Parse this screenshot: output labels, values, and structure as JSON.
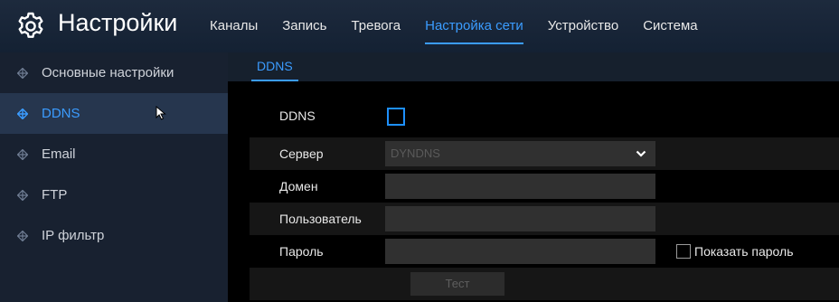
{
  "header": {
    "title": "Настройки",
    "gear_icon": "gear-icon"
  },
  "menu": {
    "items": [
      {
        "label": "Каналы"
      },
      {
        "label": "Запись"
      },
      {
        "label": "Тревога"
      },
      {
        "label": "Настройка сети",
        "active": true
      },
      {
        "label": "Устройство"
      },
      {
        "label": "Система"
      }
    ]
  },
  "sidebar": {
    "items": [
      {
        "label": "Основные настройки",
        "icon": "diamond-icon"
      },
      {
        "label": "DDNS",
        "icon": "diamond-icon",
        "active": true
      },
      {
        "label": "Email",
        "icon": "diamond-icon"
      },
      {
        "label": "FTP",
        "icon": "diamond-icon"
      },
      {
        "label": "IP фильтр",
        "icon": "diamond-icon"
      }
    ]
  },
  "tabs": [
    {
      "label": "DDNS",
      "active": true
    }
  ],
  "form": {
    "ddns": {
      "label": "DDNS",
      "checked": false
    },
    "server": {
      "label": "Сервер",
      "value": "DYNDNS"
    },
    "domain": {
      "label": "Домен",
      "value": ""
    },
    "user": {
      "label": "Пользователь",
      "value": ""
    },
    "password": {
      "label": "Пароль",
      "value": "",
      "show_label": "Показать пароль",
      "show_checked": false
    },
    "test_button": "Тест"
  },
  "colors": {
    "accent": "#3b9cff",
    "checkbox_border": "#1e90ff",
    "sidebar_bg": "#182130",
    "sidebar_active_bg": "#26364e",
    "topbar_bg": "#1a2738",
    "field_bg": "#303030"
  }
}
